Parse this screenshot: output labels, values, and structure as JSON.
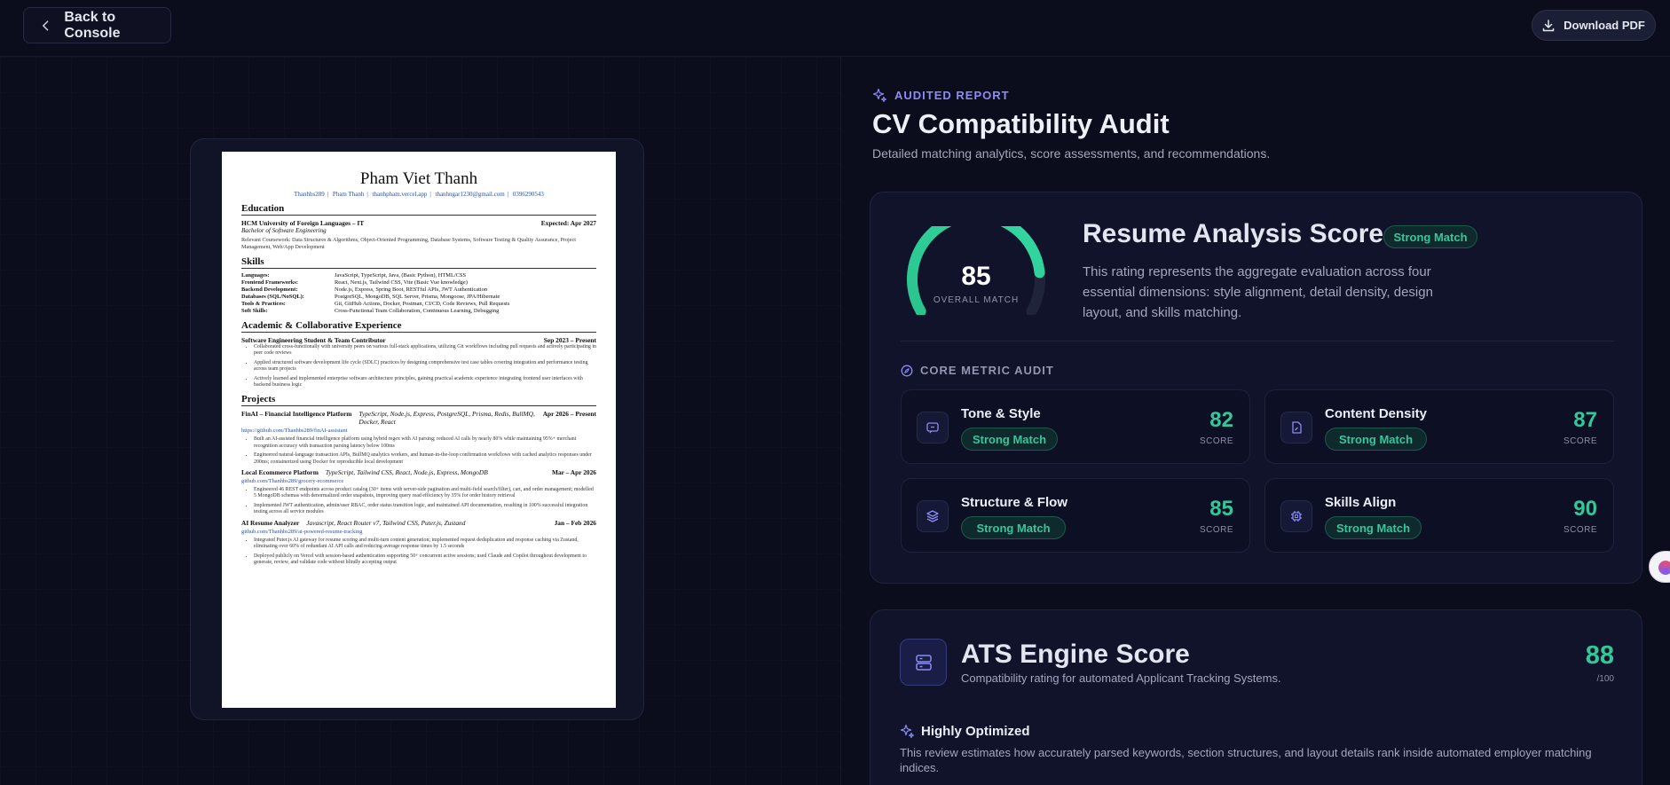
{
  "topbar": {
    "back_label": "Back to Console",
    "download_label": "Download PDF"
  },
  "resume": {
    "name": "Pham Viet Thanh",
    "contacts": [
      "Thanhbs289",
      "Pham Thanh",
      "thanhpham.vercel.app",
      "thanhngar1230@gmail.com",
      "0396290543"
    ],
    "education_heading": "Education",
    "school": "HCM University of Foreign Languages – IT",
    "school_date": "Expected: Apr 2027",
    "degree": "Bachelor of Software Engineering",
    "coursework": "Relevant Coursework: Data Structures & Algorithms, Object-Oriented Programming, Database Systems, Software Testing & Quality Assurance, Project Management, Web/App Development",
    "skills_heading": "Skills",
    "skills": [
      {
        "k": "Languages:",
        "v": "JavaScript, TypeScript, Java, (Basic Python), HTML/CSS"
      },
      {
        "k": "Frontend Frameworks:",
        "v": "React, Next.js, Tailwind CSS, Vite (Basic Vue knowledge)"
      },
      {
        "k": "Backend Development:",
        "v": "Node.js, Express, Spring Boot, RESTful APIs, JWT Authentication"
      },
      {
        "k": "Databases (SQL/NoSQL):",
        "v": "PostgreSQL, MongoDB, SQL Server, Prisma, Mongoose, JPA/Hibernate"
      },
      {
        "k": "Tools & Practices:",
        "v": "Git, GitHub Actions, Docker, Postman, CI/CD, Code Reviews, Pull Requests"
      },
      {
        "k": "Soft Skills:",
        "v": "Cross-Functional Team Collaboration, Continuous Learning, Debugging"
      }
    ],
    "experience_heading": "Academic & Collaborative Experience",
    "role": "Software Engineering Student & Team Contributor",
    "role_date": "Sep 2023 – Present",
    "role_bullets": [
      "Collaborated cross-functionally with university peers on various full-stack applications, utilizing Git workflows including pull requests and actively participating in peer code reviews",
      "Applied structured software development life cycle (SDLC) practices by designing comprehensive test case tables covering integration and performance testing across team projects",
      "Actively learned and implemented enterprise software architecture principles, gaining practical academic experience integrating frontend user interfaces with backend business logic"
    ],
    "projects_heading": "Projects",
    "projects": [
      {
        "name": "FinAI – Financial Intelligence Platform",
        "tech": "TypeScript, Node.js, Express, PostgreSQL, Prisma, Redis, BullMQ, Docker, React",
        "date": "Apr 2026 – Present",
        "link": "https://github.com/Thanhbs289/finAI-assistant",
        "bullets": [
          "Built an AI-assisted financial intelligence platform using hybrid regex with AI parsing; reduced AI calls by nearly 80% while maintaining 95%+ merchant recognition accuracy with transaction parsing latency below 100ms",
          "Engineered natural-language transaction APIs, BullMQ analytics workers, and human-in-the-loop confirmation workflows with cached analytics responses under 200ms; containerized using Docker for reproducible local development"
        ]
      },
      {
        "name": "Local Ecommerce Platform",
        "tech": "TypeScript, Tailwind CSS, React, Node.js, Express, MongoDB",
        "date": "Mar – Apr 2026",
        "link": "github.com/Thanhbs289/grocery-ecommerce",
        "bullets": [
          "Engineered 46 REST endpoints across product catalog (30+ items with server-side pagination and multi-field search/filter), cart, and order management; modelled 5 MongoDB schemas with denormalized order snapshots, improving query read efficiency by 35% for order history retrieval",
          "Implemented JWT authentication, admin/user RBAC, order status transition logic, and maintained API documentation, resulting in 100% successful integration testing across all service modules"
        ]
      },
      {
        "name": "AI Resume Analyzer",
        "tech": "Javascript, React Router v7, Tailwind CSS, Puter.js, Zustand",
        "date": "Jan – Feb 2026",
        "link": "github.com/Thanhbs289/ai-powered-resume-tracking",
        "bullets": [
          "Integrated Puter.js AI gateway for resume scoring and multi-turn content generation; implemented request deduplication and response caching via Zustand, eliminating over 60% of redundant AI API calls and reducing average response times by 1.5 seconds",
          "Deployed publicly on Vercel with session-based authentication supporting 50+ concurrent active sessions; used Claude and Copilot throughout development to generate, review, and validate code without blindly accepting output"
        ]
      }
    ]
  },
  "report": {
    "eyebrow": "AUDITED REPORT",
    "title": "CV Compatibility Audit",
    "subtitle": "Detailed matching analytics, score assessments, and recommendations."
  },
  "analysis": {
    "score": "85",
    "score_fraction": 0.85,
    "score_label": "OVERALL MATCH",
    "title": "Resume Analysis Score",
    "badge": "Strong Match",
    "description": "This rating represents the aggregate evaluation across four essential dimensions: style alignment, detail density, design layout, and skills matching.",
    "core_label": "CORE METRIC AUDIT",
    "metrics": [
      {
        "name": "Tone & Style",
        "badge": "Strong Match",
        "score": "82",
        "unit": "SCORE",
        "icon": "chat-icon"
      },
      {
        "name": "Content Density",
        "badge": "Strong Match",
        "score": "87",
        "unit": "SCORE",
        "icon": "document-icon"
      },
      {
        "name": "Structure & Flow",
        "badge": "Strong Match",
        "score": "85",
        "unit": "SCORE",
        "icon": "layers-icon"
      },
      {
        "name": "Skills Align",
        "badge": "Strong Match",
        "score": "90",
        "unit": "SCORE",
        "icon": "chip-icon"
      }
    ]
  },
  "ats": {
    "title": "ATS Engine Score",
    "subtitle": "Compatibility rating for automated Applicant Tracking Systems.",
    "score": "88",
    "unit": "/100",
    "status": "Highly Optimized",
    "description": "This review estimates how accurately parsed keywords, section structures, and layout details rank inside automated employer matching indices."
  },
  "colors": {
    "accent_green": "#34c79a",
    "accent_purple": "#8b8cf5",
    "background": "#0b0c1c"
  }
}
